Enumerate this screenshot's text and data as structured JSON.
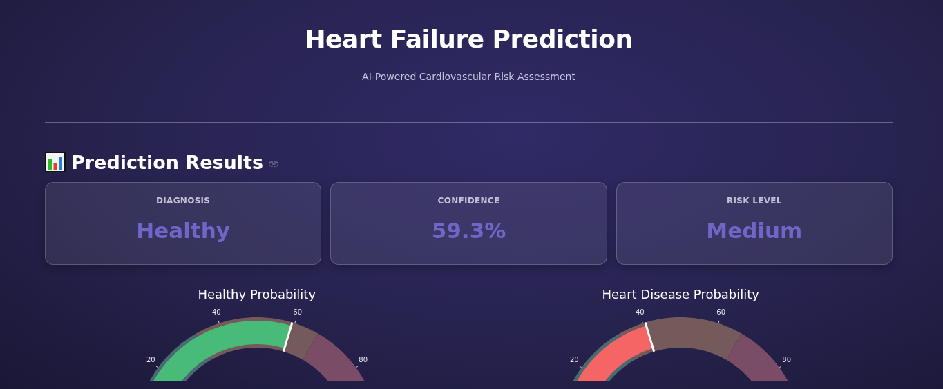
{
  "header": {
    "title": "Heart Failure Prediction",
    "subtitle": "AI-Powered Cardiovascular Risk Assessment"
  },
  "results": {
    "heading": "Prediction Results",
    "cards": [
      {
        "label": "DIAGNOSIS",
        "value": "Healthy"
      },
      {
        "label": "CONFIDENCE",
        "value": "59.3%"
      },
      {
        "label": "RISK LEVEL",
        "value": "Medium"
      }
    ]
  },
  "gauges": [
    {
      "title": "Healthy Probability",
      "level": 0.593,
      "color": "#48bb78",
      "ticks": [
        "20",
        "40",
        "60",
        "80"
      ]
    },
    {
      "title": "Heart Disease Probability",
      "level": 0.407,
      "color": "#f56565",
      "ticks": [
        "20",
        "40",
        "60",
        "80"
      ]
    }
  ]
}
